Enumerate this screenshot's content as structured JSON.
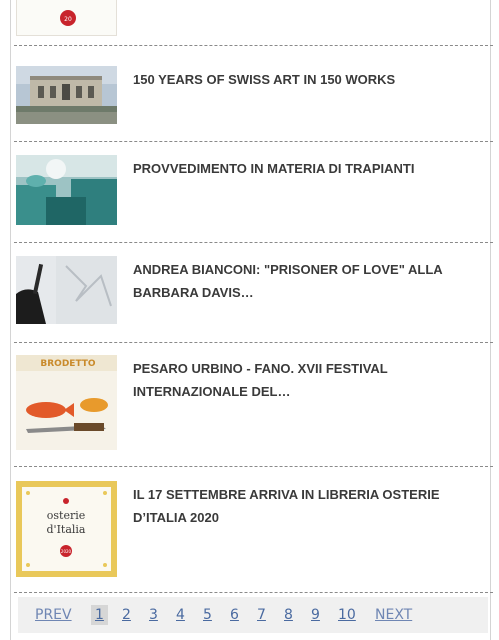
{
  "articles": [
    {
      "title": ""
    },
    {
      "title": "150 YEARS OF SWISS ART IN 150 WORKS"
    },
    {
      "title": "PROVVEDIMENTO IN MATERIA DI TRAPIANTI"
    },
    {
      "title": "ANDREA BIANCONI: \"PRISONER OF LOVE\" ALLA BARBARA DAVIS…"
    },
    {
      "title": "PESARO URBINO - FANO. XVII FESTIVAL INTERNAZIONALE DEL…"
    },
    {
      "title": "IL 17 SETTEMBRE ARRIVA IN LIBRERIA OSTERIE D’ITALIA 2020"
    }
  ],
  "thumbs": {
    "badge_text": "20",
    "brodetto_banner": "BRODETTO",
    "osterie_line1": "osterie",
    "osterie_line2": "d'Italia",
    "osterie_year": "2020"
  },
  "pagination": {
    "prev": "PREV",
    "pages": [
      "1",
      "2",
      "3",
      "4",
      "5",
      "6",
      "7",
      "8",
      "9",
      "10"
    ],
    "current": "1",
    "next": "NEXT"
  },
  "colors": {
    "title": "#3a3a3a",
    "link": "#4a6aa0",
    "separator": "#8a8a8a"
  }
}
